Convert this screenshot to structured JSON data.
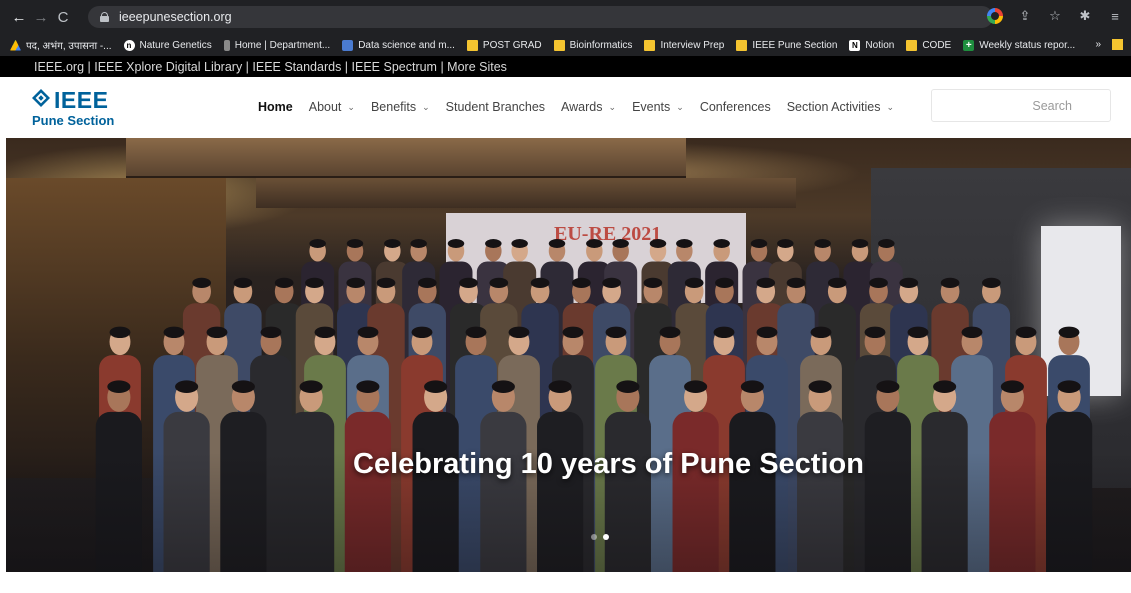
{
  "browser": {
    "url": "ieeepunesection.org",
    "bookmarks": [
      {
        "label": "पद, अभंग, उपासना -...",
        "icon": "drive"
      },
      {
        "label": "Nature Genetics",
        "icon": "n"
      },
      {
        "label": "Home | Department...",
        "icon": "bar"
      },
      {
        "label": "Data science and m...",
        "icon": "ds"
      },
      {
        "label": "POST GRAD",
        "icon": "folder"
      },
      {
        "label": "Bioinformatics",
        "icon": "folder"
      },
      {
        "label": "Interview Prep",
        "icon": "folder"
      },
      {
        "label": "IEEE Pune Section",
        "icon": "folder"
      },
      {
        "label": "Notion",
        "icon": "notion"
      },
      {
        "label": "CODE",
        "icon": "folder"
      },
      {
        "label": "Weekly status repor...",
        "icon": "plus"
      }
    ],
    "more": "»"
  },
  "ieee_strip": {
    "text": "IEEE.org | IEEE Xplore Digital Library | IEEE Standards | IEEE Spectrum | More Sites"
  },
  "header": {
    "logo_text": "IEEE",
    "logo_sub": "Pune Section",
    "menu": [
      {
        "label": "Home",
        "dropdown": false,
        "active": true
      },
      {
        "label": "About",
        "dropdown": true,
        "active": false
      },
      {
        "label": "Benefits",
        "dropdown": true,
        "active": false
      },
      {
        "label": "Student Branches",
        "dropdown": false,
        "active": false
      },
      {
        "label": "Awards",
        "dropdown": true,
        "active": false
      },
      {
        "label": "Events",
        "dropdown": true,
        "active": false
      },
      {
        "label": "Conferences",
        "dropdown": false,
        "active": false
      },
      {
        "label": "Section Activities",
        "dropdown": true,
        "active": false
      }
    ],
    "search_placeholder": "Search"
  },
  "hero": {
    "banner_text": "EU-RE 2021",
    "title": "Celebrating 10 years of Pune Section",
    "slides": 2,
    "active_slide": 1
  },
  "colors": {
    "ieee_blue": "#00629b",
    "chrome_bg": "#202124",
    "strip_bg": "#000000"
  }
}
